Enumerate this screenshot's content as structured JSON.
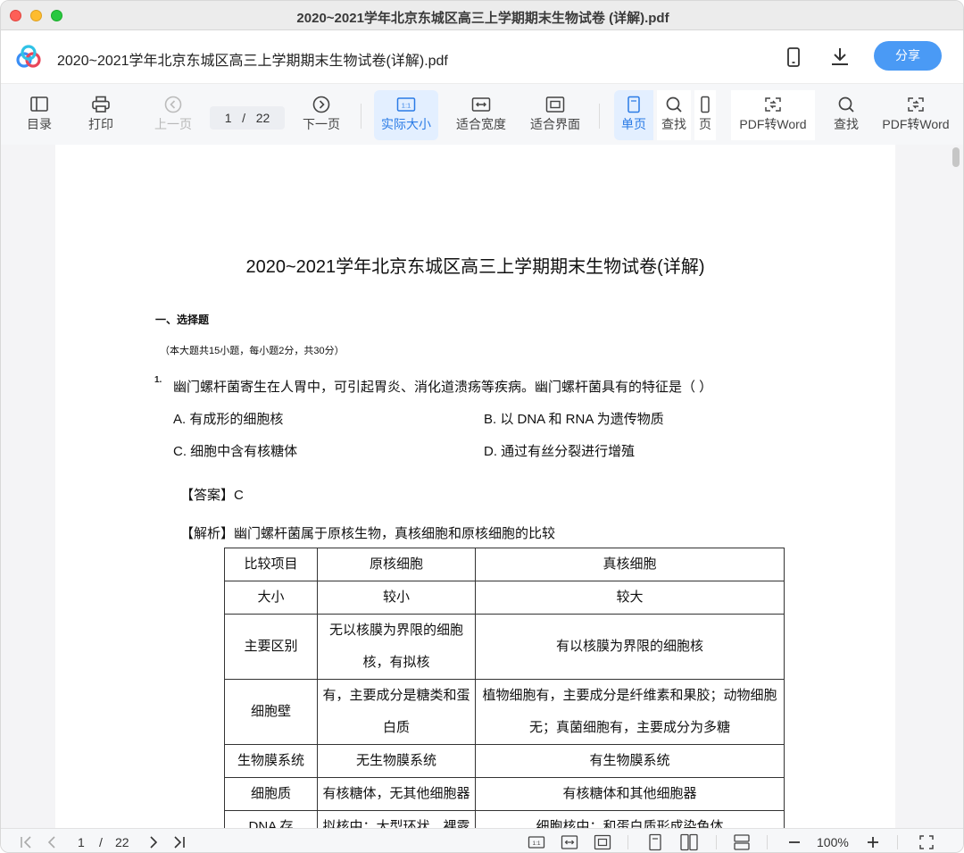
{
  "window": {
    "title": "2020~2021学年北京东城区高三上学期期末生物试卷 (详解).pdf"
  },
  "header": {
    "doc_title": "2020~2021学年北京东城区高三上学期期末生物试卷(详解).pdf",
    "share_label": "分享"
  },
  "toolbar": {
    "toc": "目录",
    "print": "打印",
    "prev": "上一页",
    "page_current": "1",
    "page_sep": "/",
    "page_total": "22",
    "next": "下一页",
    "actual_size": "实际大小",
    "fit_width": "适合宽度",
    "fit_page": "适合界面",
    "single_page": "单页",
    "find": "查找",
    "page_partial": "页",
    "pdf_to_word": "PDF转Word",
    "find2": "查找",
    "pdf_to_word2": "PDF转Word"
  },
  "doc": {
    "title": "2020~2021学年北京东城区高三上学期期末生物试卷(详解)",
    "section_head": "一、选择题",
    "section_note": "（本大题共15小题，每小题2分，共30分）",
    "q1_num": "1.",
    "q1_text": "幽门螺杆菌寄生在人胃中，可引起胃炎、消化道溃疡等疾病。幽门螺杆菌具有的特征是（    ）",
    "q1_options": {
      "a": "A. 有成形的细胞核",
      "b": "B. 以 DNA 和 RNA 为遗传物质",
      "c": "C. 细胞中含有核糖体",
      "d": "D. 通过有丝分裂进行增殖"
    },
    "answer": "【答案】C",
    "analysis": "【解析】幽门螺杆菌属于原核生物，真核细胞和原核细胞的比较",
    "table": {
      "header": [
        "比较项目",
        "原核细胞",
        "真核细胞"
      ],
      "rows": [
        [
          "大小",
          "较小",
          "较大"
        ],
        [
          "主要区别",
          "无以核膜为界限的细胞核，有拟核",
          "有以核膜为界限的细胞核"
        ],
        [
          "细胞壁",
          "有，主要成分是糖类和蛋白质",
          "植物细胞有，主要成分是纤维素和果胶；动物细胞无；真菌细胞有，主要成分为多糖"
        ],
        [
          "生物膜系统",
          "无生物膜系统",
          "有生物膜系统"
        ],
        [
          "细胞质",
          "有核糖体，无其他细胞器",
          "有核糖体和其他细胞器"
        ],
        [
          "DNA 存",
          "拟核中：大型环状、裸露",
          "细胞核中：和蛋白质形成染色体"
        ]
      ]
    }
  },
  "bottom": {
    "page_current": "1",
    "page_sep": "/",
    "page_total": "22",
    "zoom": "100%"
  },
  "colors": {
    "accent": "#4a9af5",
    "active_bg": "#e3efff",
    "active_text": "#2a7be6"
  }
}
